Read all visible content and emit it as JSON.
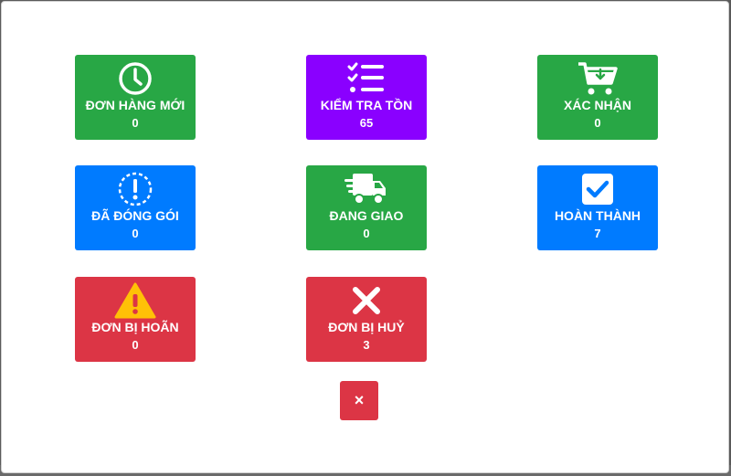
{
  "tiles": [
    {
      "label": "ĐƠN HÀNG MỚI",
      "count": "0",
      "icon": "clock-icon",
      "color": "#28a745"
    },
    {
      "label": "KIỂM TRA TỒN",
      "count": "65",
      "icon": "checklist-icon",
      "color": "#8a00ff"
    },
    {
      "label": "XÁC NHẬN",
      "count": "0",
      "icon": "cart-download-icon",
      "color": "#28a745"
    },
    {
      "label": "ĐÃ ĐÓNG GÓI",
      "count": "0",
      "icon": "exclamation-circle-icon",
      "color": "#007bff"
    },
    {
      "label": "ĐANG GIAO",
      "count": "0",
      "icon": "delivery-truck-icon",
      "color": "#28a745"
    },
    {
      "label": "HOÀN THÀNH",
      "count": "7",
      "icon": "checkbox-checked-icon",
      "color": "#007bff"
    },
    {
      "label": "ĐƠN BỊ HOÃN",
      "count": "0",
      "icon": "warning-triangle-icon",
      "color": "#dc3545"
    },
    {
      "label": "ĐƠN BỊ HUỶ",
      "count": "3",
      "icon": "x-mark-icon",
      "color": "#dc3545"
    }
  ],
  "close_button": {
    "label": "×",
    "icon": "close-icon"
  }
}
